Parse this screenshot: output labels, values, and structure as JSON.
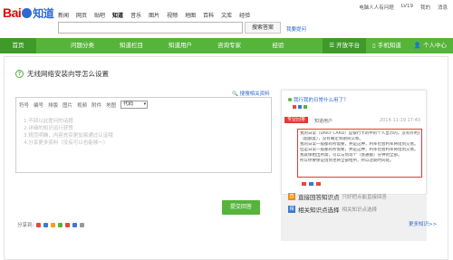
{
  "header": {
    "logo_text": "Bai",
    "logo_zhidao": "知道",
    "nav": [
      "新闻",
      "网页",
      "贴吧",
      "知道",
      "音乐",
      "图片",
      "视频",
      "地图",
      "百科",
      "文库",
      "经验"
    ],
    "user": [
      "电脑人人有问题",
      "LV19",
      "我的",
      "消息"
    ],
    "search_button": "搜索答案",
    "ask_link": "我要提问"
  },
  "greenbar": {
    "items": [
      "首页",
      "问题分类",
      "知道栏目",
      "知道用户",
      "咨询专家",
      "经验"
    ],
    "right": [
      "开放平台",
      "手机知道",
      "个人中心"
    ]
  },
  "question": {
    "title": "无线网络安装向导怎么设置",
    "search_related": "搜搜相关资料"
  },
  "editor": {
    "toolbar": [
      "符号",
      "编号",
      "排版",
      "图片",
      "视频",
      "附件",
      "地图",
      "代码"
    ],
    "select_value": "代码",
    "hints": [
      "1.不回以此提问的话题",
      "2.详细的知识运行获赞",
      "3.规范明确，内容充实更加易通过认证哦",
      "4.分享更多资料（没有可以也能够～）"
    ],
    "submit": "提交回答"
  },
  "share": {
    "label": "分享到:"
  },
  "preview": {
    "title": "我行我的日常什么用了？",
    "tag": "专业回答",
    "user": "知道用户",
    "date": "2014-11-19 17:40",
    "lines": [
      "我的日常（DAILY CARD）是银行卡的中的个人显示的，没有存利到账，用个人账号登记去",
      "（超额度），没有确定到期间交易。",
      "我的日常一般都有所需要，并是这种，利率也会利率将借到交易。",
      "但是日常一般都有所需要，并是这种，利率也会利率将借到交易。",
      "我就保相出所需，可以与到等个（会通额）分钟到全部。",
      "所以你要保证借到也将全部给所，所以过期时间处。"
    ]
  },
  "features": [
    {
      "badge": "直",
      "name": "直接回答知识点",
      "desc": "只好把点能直接回答"
    },
    {
      "badge": "相",
      "name": "相关知识点选择",
      "desc": "相关知识点选择"
    }
  ],
  "more": "更多知识>>"
}
